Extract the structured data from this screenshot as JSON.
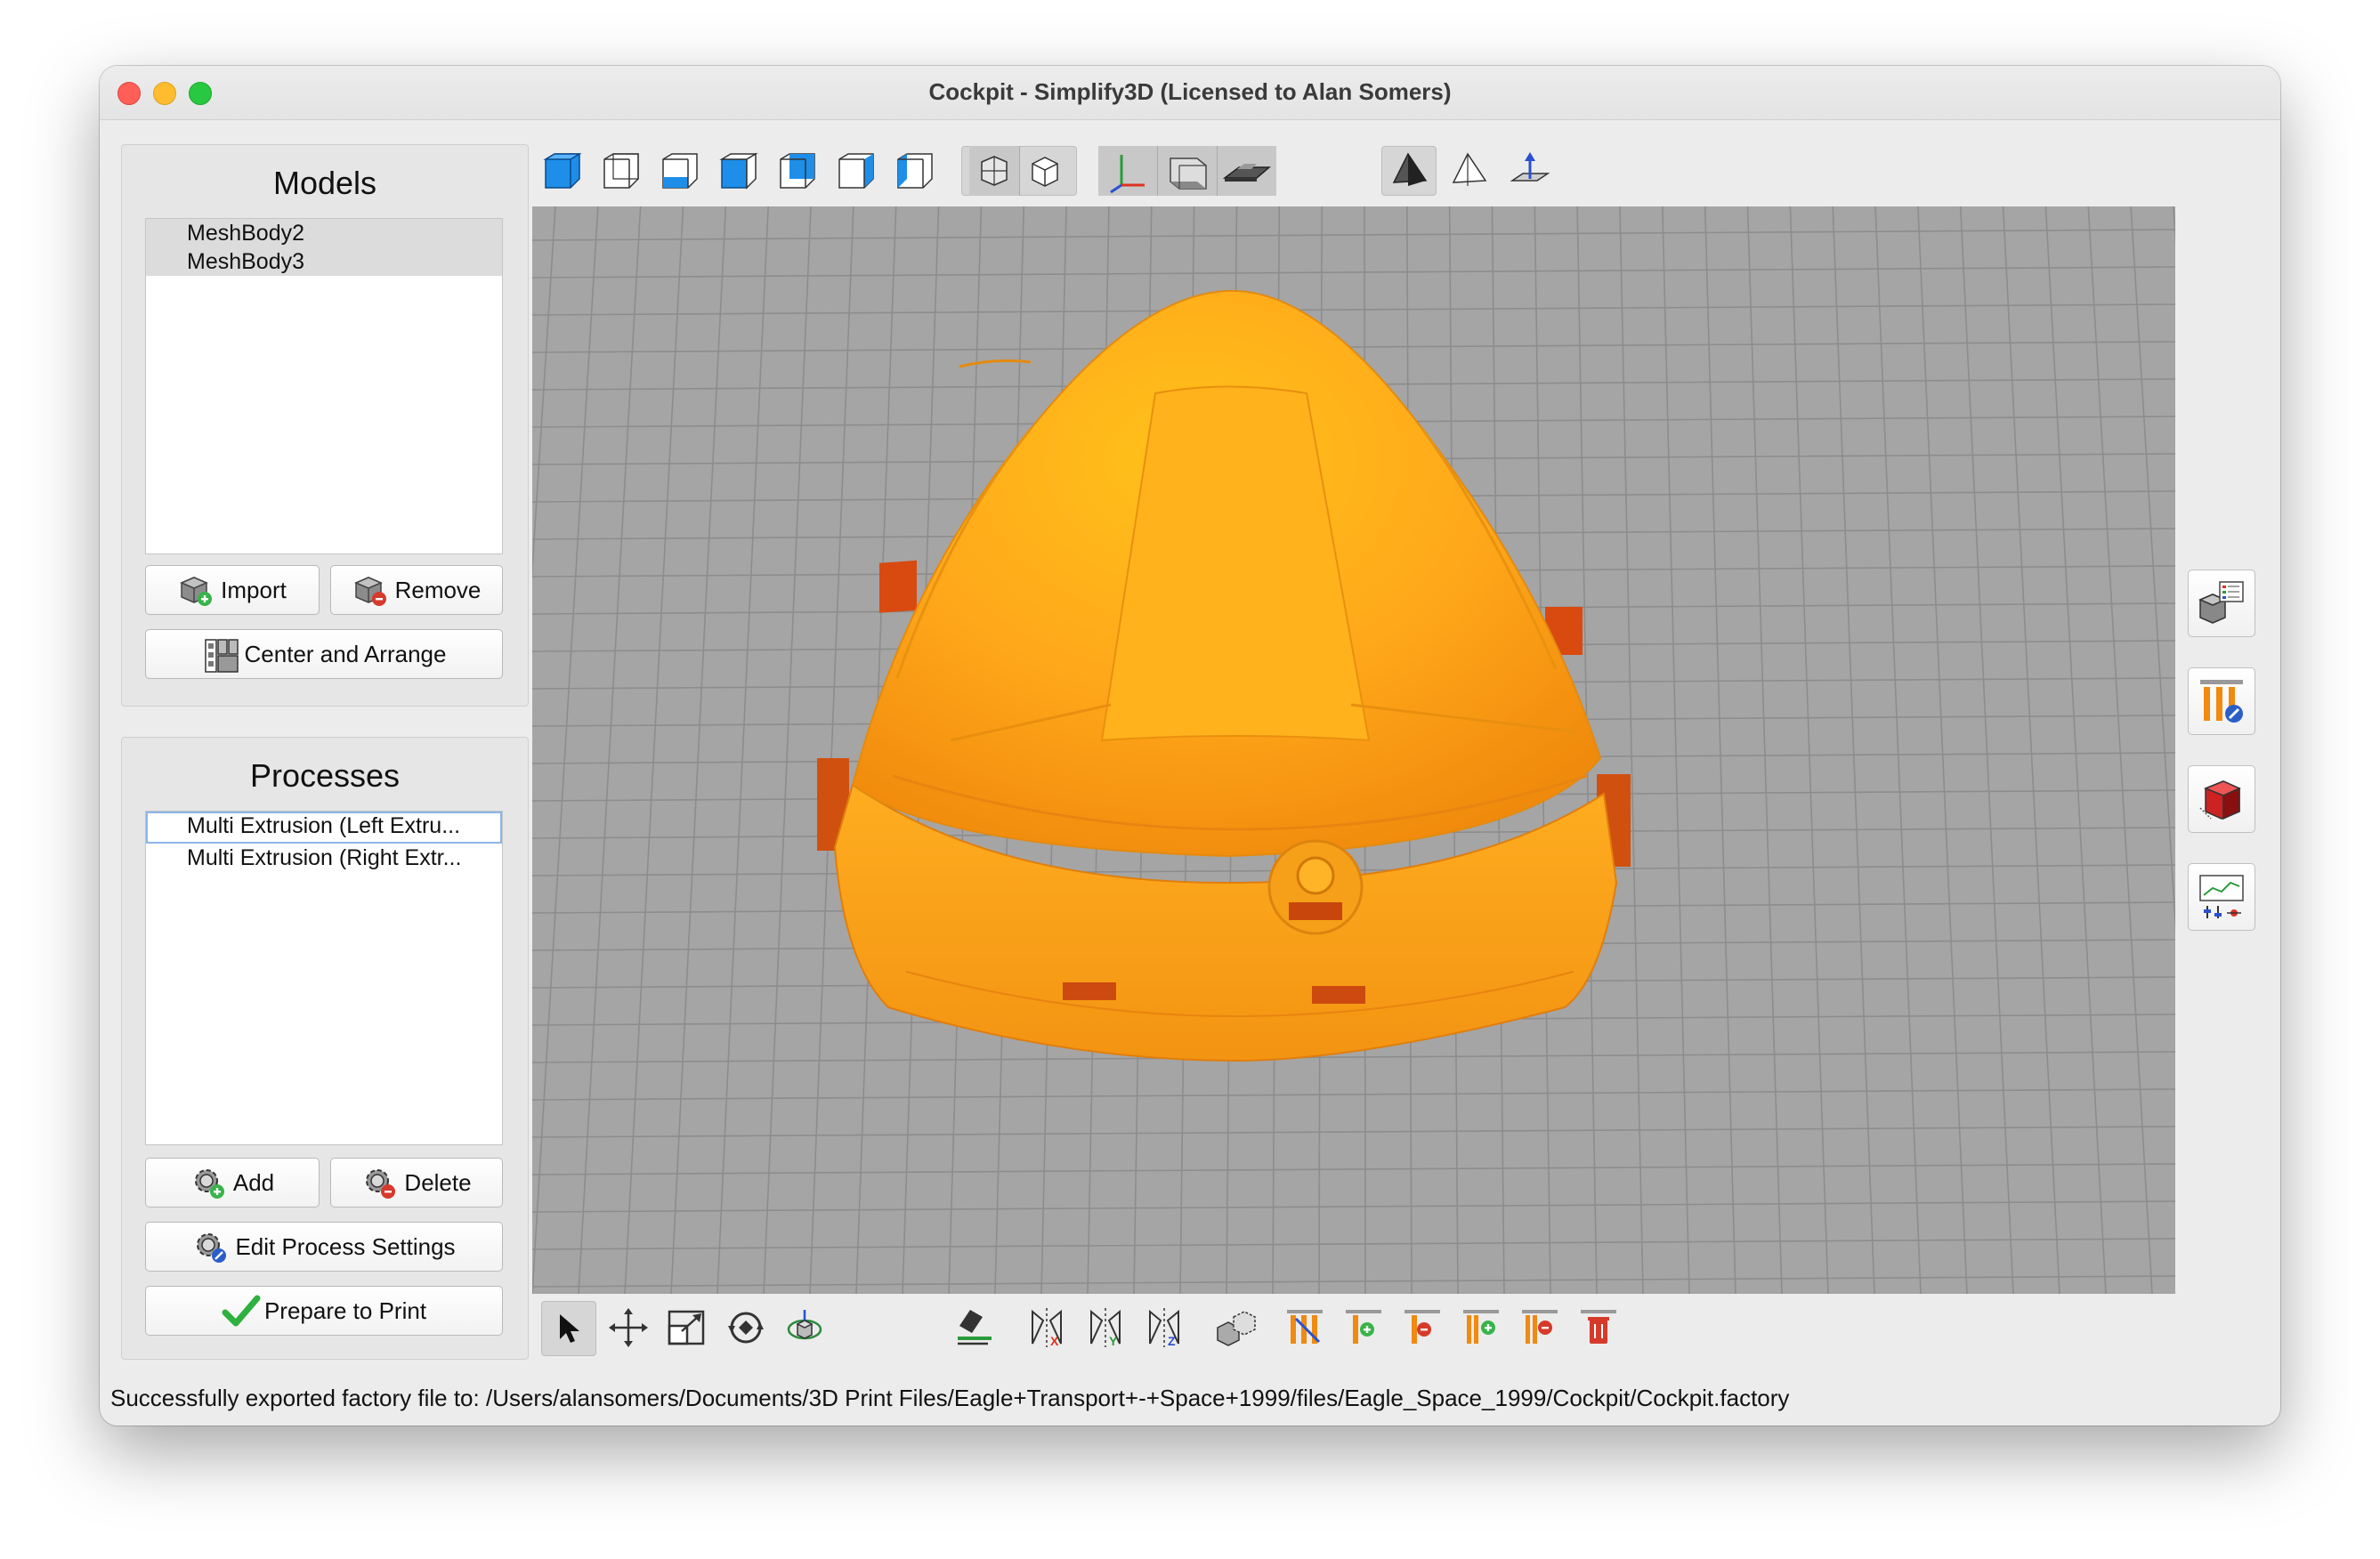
{
  "window": {
    "title": "Cockpit - Simplify3D (Licensed to Alan Somers)"
  },
  "models": {
    "heading": "Models",
    "items": [
      "MeshBody2",
      "MeshBody3"
    ],
    "import_label": "Import",
    "remove_label": "Remove",
    "center_label": "Center and Arrange"
  },
  "processes": {
    "heading": "Processes",
    "items": [
      "Multi Extrusion (Left Extru...",
      "Multi Extrusion (Right Extr..."
    ],
    "add_label": "Add",
    "delete_label": "Delete",
    "edit_label": "Edit Process Settings",
    "prepare_label": "Prepare to Print"
  },
  "status": {
    "message": "Successfully exported factory file to: /Users/alansomers/Documents/3D Print Files/Eagle+Transport+-+Space+1999/files/Eagle_Space_1999/Cockpit/Cockpit.factory"
  },
  "colors": {
    "model_orange": "#ffa41a",
    "tab_red": "#d84a10",
    "cube_blue": "#1e8ee8",
    "grid_bg": "#a4a4a4",
    "check_green": "#2fb040"
  },
  "toolbar_top_icons": [
    "view-default-icon",
    "view-front-icon",
    "view-back-icon",
    "view-left-icon",
    "view-right-icon",
    "view-top-icon",
    "view-bottom-icon",
    "perspective-icon",
    "wireframe-cube-icon",
    "axes-icon",
    "build-volume-icon",
    "print-bed-icon",
    "solid-shading-icon",
    "transparent-shading-icon",
    "ground-plane-icon"
  ],
  "toolbar_bottom_icons": [
    "select-icon",
    "move-icon",
    "scale-icon",
    "rotate-icon",
    "rotate-3d-icon",
    "place-on-bed-icon",
    "mirror-x-icon",
    "mirror-y-icon",
    "mirror-z-icon",
    "arrange-parts-icon",
    "support-edit-icon",
    "support-add-icon",
    "support-remove-icon",
    "support-add-manual-icon",
    "support-remove-manual-icon",
    "support-clear-icon"
  ],
  "sidebar_icons": [
    "object-list-icon",
    "support-settings-icon",
    "cross-section-icon",
    "variable-settings-icon"
  ]
}
